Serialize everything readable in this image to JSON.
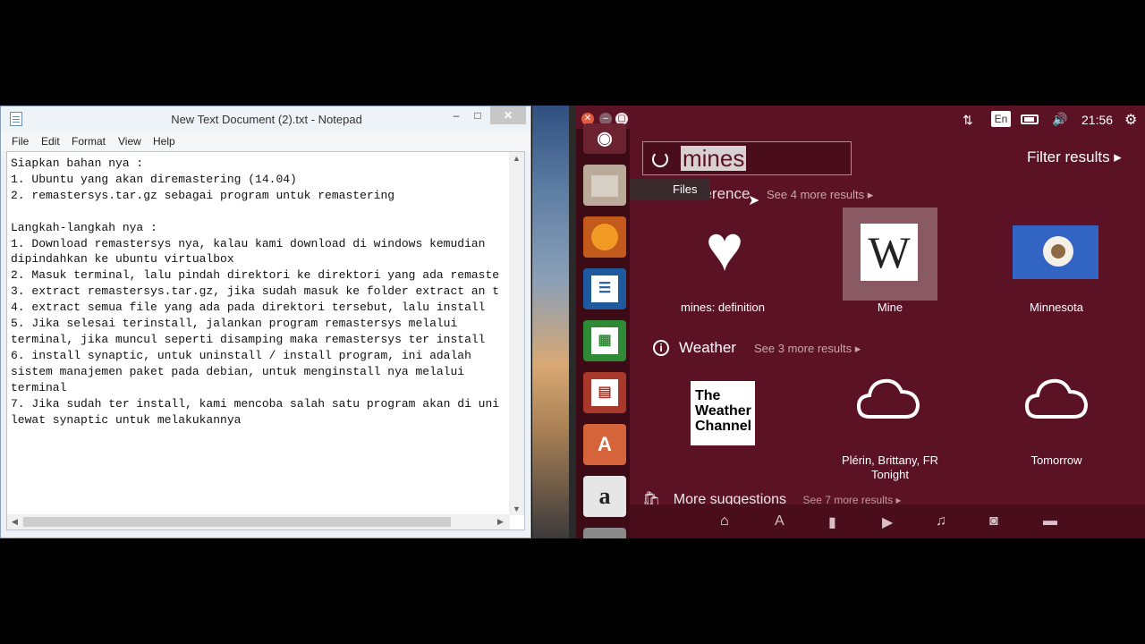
{
  "notepad": {
    "title": "New Text Document (2).txt - Notepad",
    "controls": {
      "minimize": "–",
      "maximize": "□",
      "close": "✕"
    },
    "menu": [
      "File",
      "Edit",
      "Format",
      "View",
      "Help"
    ],
    "text": "Siapkan bahan nya :\n1. Ubuntu yang akan diremastering (14.04)\n2. remastersys.tar.gz sebagai program untuk remastering\n\nLangkah-langkah nya :\n1. Download remastersys nya, kalau kami download di windows kemudian\ndipindahkan ke ubuntu virtualbox\n2. Masuk terminal, lalu pindah direktori ke direktori yang ada remaste\n3. extract remastersys.tar.gz, jika sudah masuk ke folder extract an t\n4. extract semua file yang ada pada direktori tersebut, lalu install\n5. Jika selesai terinstall, jalankan program remastersys melalui\nterminal, jika muncul seperti disamping maka remastersys ter install\n6. install synaptic, untuk uninstall / install program, ini adalah\nsistem manajemen paket pada debian, untuk menginstall nya melalui\nterminal\n7. Jika sudah ter install, kami mencoba salah satu program akan di uni\nlewat synaptic untuk melakukannya"
  },
  "ubuntu": {
    "window_controls": {
      "close": "✕",
      "minimize": "–",
      "maximize": "▢"
    },
    "indicators": {
      "network": "⇅",
      "language": "En",
      "volume": "🔊",
      "clock": "21:56",
      "settings": "⚙"
    },
    "search": {
      "query": "mines"
    },
    "filter_results": "Filter results ▸",
    "tooltip": "Files",
    "categories": {
      "reference": {
        "title": "Reference",
        "see_more": "See 4 more results ▸"
      },
      "weather": {
        "title": "Weather",
        "see_more": "See 3 more results ▸"
      },
      "more": {
        "title": "More suggestions",
        "see_more": "See 7 more results ▸"
      }
    },
    "reference_results": [
      "mines: definition",
      "Mine",
      "Minnesota"
    ],
    "weather_results": {
      "twc_logo": [
        "The",
        "Weather",
        "Channel"
      ],
      "plerin": [
        "Plérin, Brittany, FR",
        "Tonight"
      ],
      "tomorrow": "Tomorrow"
    },
    "launcher_icons": [
      "ubuntu-logo",
      "files",
      "firefox",
      "libreoffice-writer",
      "libreoffice-calc",
      "libreoffice-impress",
      "software-center",
      "amazon",
      "system-settings"
    ],
    "lens_icons": [
      "home",
      "applications",
      "files",
      "video",
      "music",
      "photos",
      "social"
    ]
  }
}
